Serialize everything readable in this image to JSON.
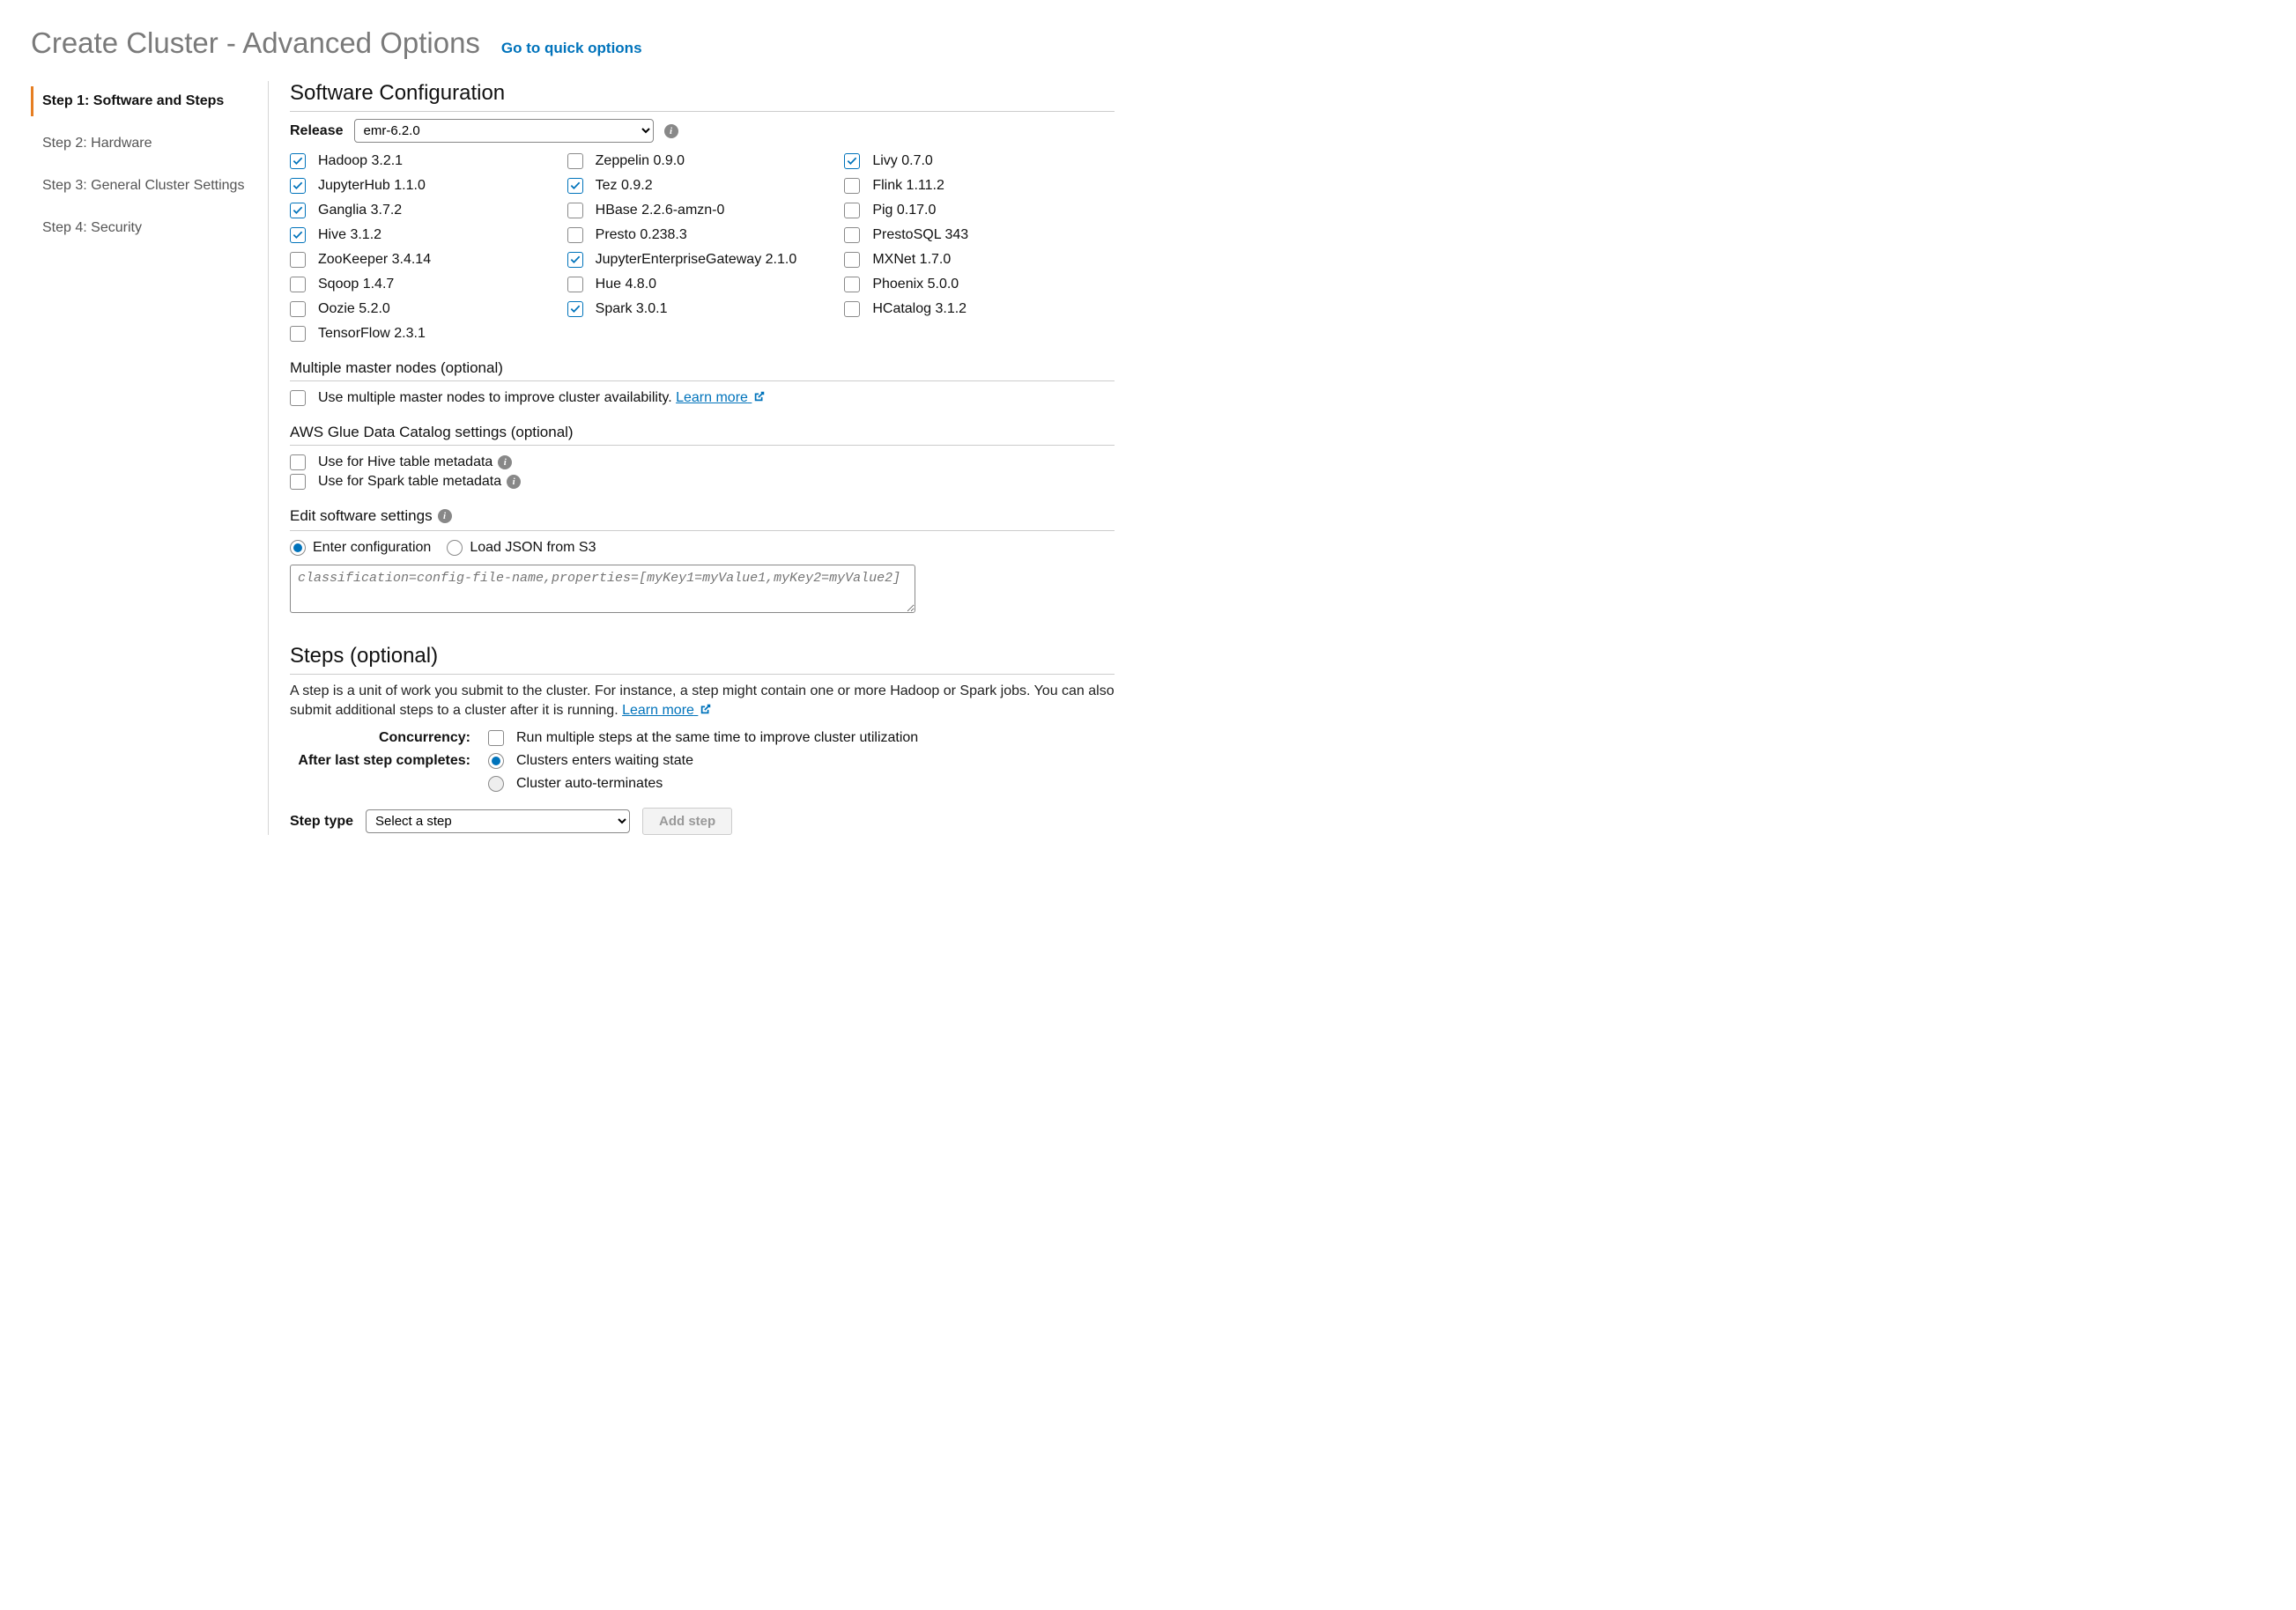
{
  "header": {
    "title": "Create Cluster - Advanced Options",
    "quick_link": "Go to quick options"
  },
  "sidebar": {
    "steps": [
      {
        "label": "Step 1: Software and Steps",
        "active": true
      },
      {
        "label": "Step 2: Hardware",
        "active": false
      },
      {
        "label": "Step 3: General Cluster Settings",
        "active": false
      },
      {
        "label": "Step 4: Security",
        "active": false
      }
    ]
  },
  "software": {
    "title": "Software Configuration",
    "release_label": "Release",
    "release_value": "emr-6.2.0",
    "items": [
      [
        {
          "label": "Hadoop 3.2.1",
          "checked": true
        },
        {
          "label": "JupyterHub 1.1.0",
          "checked": true
        },
        {
          "label": "Ganglia 3.7.2",
          "checked": true
        },
        {
          "label": "Hive 3.1.2",
          "checked": true
        },
        {
          "label": "ZooKeeper 3.4.14",
          "checked": false
        },
        {
          "label": "Sqoop 1.4.7",
          "checked": false
        },
        {
          "label": "Oozie 5.2.0",
          "checked": false
        },
        {
          "label": "TensorFlow 2.3.1",
          "checked": false
        }
      ],
      [
        {
          "label": "Zeppelin 0.9.0",
          "checked": false
        },
        {
          "label": "Tez 0.9.2",
          "checked": true
        },
        {
          "label": "HBase 2.2.6-amzn-0",
          "checked": false
        },
        {
          "label": "Presto 0.238.3",
          "checked": false
        },
        {
          "label": "JupyterEnterpriseGateway 2.1.0",
          "checked": true
        },
        {
          "label": "Hue 4.8.0",
          "checked": false
        },
        {
          "label": "Spark 3.0.1",
          "checked": true
        }
      ],
      [
        {
          "label": "Livy 0.7.0",
          "checked": true
        },
        {
          "label": "Flink 1.11.2",
          "checked": false
        },
        {
          "label": "Pig 0.17.0",
          "checked": false
        },
        {
          "label": "PrestoSQL 343",
          "checked": false
        },
        {
          "label": "MXNet 1.7.0",
          "checked": false
        },
        {
          "label": "Phoenix 5.0.0",
          "checked": false
        },
        {
          "label": "HCatalog 3.1.2",
          "checked": false
        }
      ]
    ]
  },
  "multiple_master": {
    "title": "Multiple master nodes (optional)",
    "label": "Use multiple master nodes to improve cluster availability.",
    "learn_more": "Learn more"
  },
  "glue": {
    "title": "AWS Glue Data Catalog settings (optional)",
    "hive": "Use for Hive table metadata",
    "spark": "Use for Spark table metadata"
  },
  "edit_settings": {
    "title": "Edit software settings",
    "radio_enter": "Enter configuration",
    "radio_s3": "Load JSON from S3",
    "placeholder": "classification=config-file-name,properties=[myKey1=myValue1,myKey2=myValue2]"
  },
  "steps": {
    "title": "Steps (optional)",
    "desc": "A step is a unit of work you submit to the cluster. For instance, a step might contain one or more Hadoop or Spark jobs. You can also submit additional steps to a cluster after it is running.",
    "learn_more": "Learn more",
    "concurrency_label": "Concurrency:",
    "concurrency_text": "Run multiple steps at the same time to improve cluster utilization",
    "after_label": "After last step completes:",
    "after_opt1": "Clusters enters waiting state",
    "after_opt2": "Cluster auto-terminates",
    "step_type_label": "Step type",
    "step_type_value": "Select a step",
    "add_step": "Add step"
  }
}
